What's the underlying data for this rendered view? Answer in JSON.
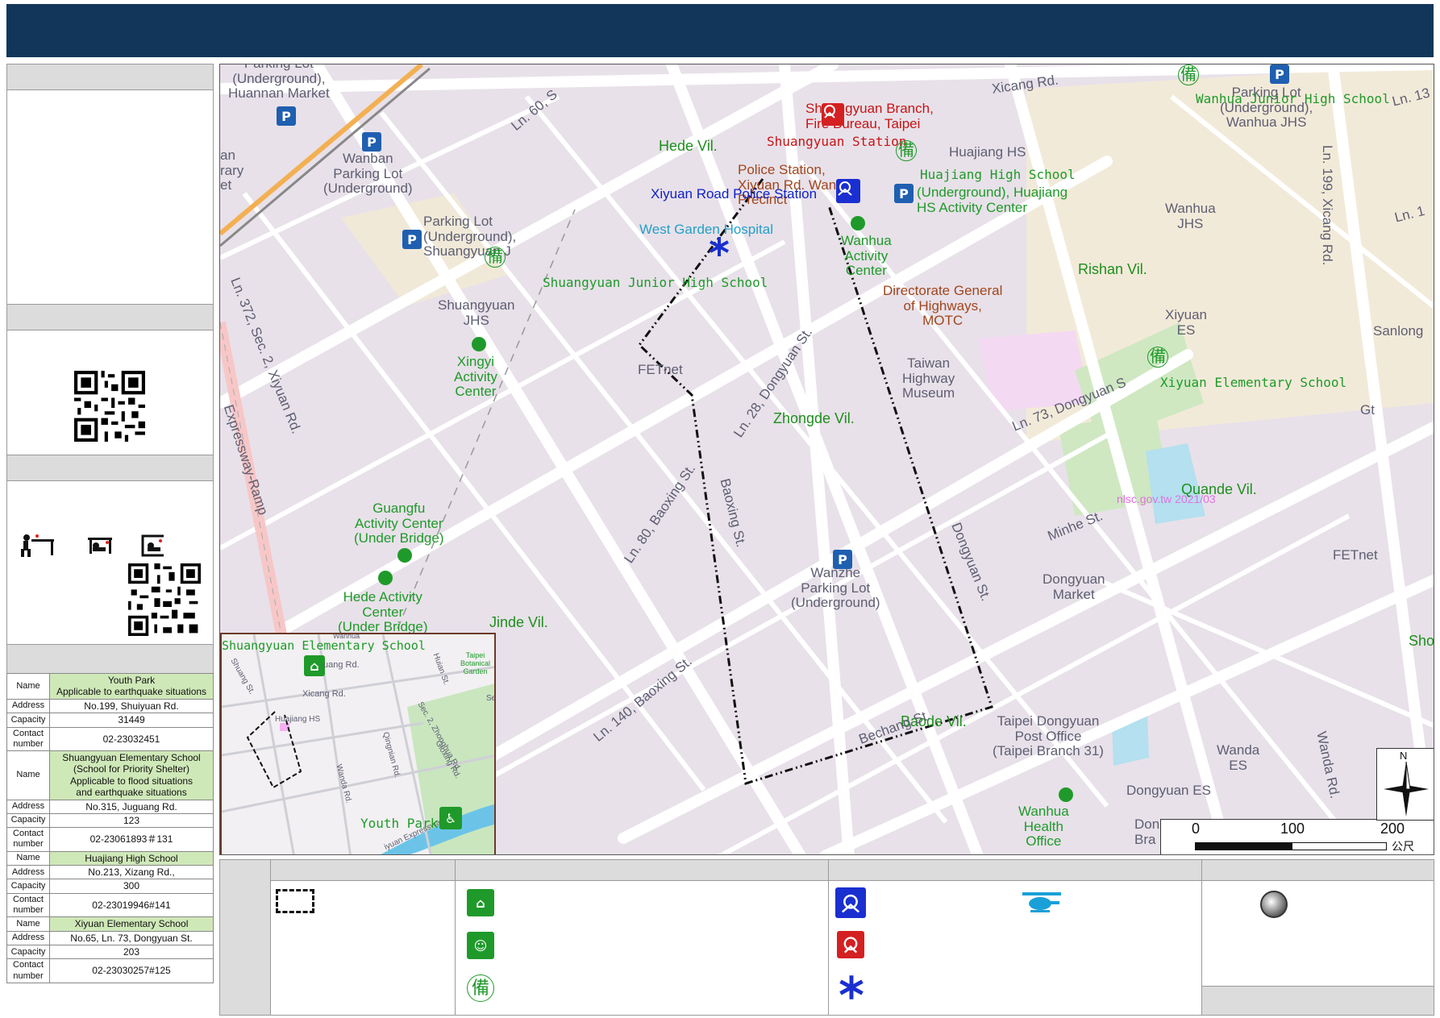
{
  "map": {
    "districts": [
      {
        "id": "hede",
        "label": "Hede Vil."
      },
      {
        "id": "rishan",
        "label": "Rishan Vil."
      },
      {
        "id": "zhongde",
        "label": "Zhongde Vil."
      },
      {
        "id": "quande",
        "label": "Quande Vil."
      },
      {
        "id": "jinde",
        "label": "Jinde Vil."
      },
      {
        "id": "baode",
        "label": "Baode Vil."
      },
      {
        "id": "sho",
        "label": "Sho"
      }
    ],
    "roads": {
      "xicang": "Xicang Rd.",
      "ln60": "Ln. 60, S",
      "ln372": "Ln. 372, Sec. 2, Xiyuan Rd.",
      "expressway": "Expressway-Ramp",
      "ln28": "Ln. 28, Dongyuan St.",
      "ln80": "Ln. 80, Baoxing St.",
      "baoxing": "Baoxing St.",
      "ln140": "Ln. 140, Baoxing St.",
      "beichang": "Bechang St.",
      "dongyuan": "Dongyuan St.",
      "ln73": "Ln. 73, Dongyuan S",
      "minhe": "Minhe St.",
      "ln199": "Ln. 199, Xicang Rd.",
      "wanda": "Wanda Rd.",
      "ln13": "Ln. 13",
      "ln1": "Ln. 1"
    },
    "places": {
      "parking_huannan": "Parking Lot\n(Underground),\nHuannan Market",
      "wanban": "Wanban\nParking Lot\n(Underground)",
      "library": "an\nrary\net",
      "parking_shuangyuan": "Parking Lot\n(Underground),\nShuangyuan J",
      "shuangyuan_jhs": "Shuangyuan\nJHS",
      "xingyi": "Xingyi\nActivity\nCenter",
      "shuangyuan_branch": "Shuangyuan Branch,\nFire Bureau, Taipei",
      "shuangyuan_station": "Shuangyuan Station",
      "police_station": "Police Station,\nXiyuan Rd. Wanhua\nPrecinct",
      "xiyuan_police": "Xiyuan Road Police Station",
      "west_garden": "West Garden Hospital",
      "shuangyuan_jhs_school": "Shuangyuan Junior High School",
      "huajiang_hs": "Huajiang HS",
      "huajiang_high": "Huajiang High School",
      "huajiang_center": "(Underground), Huajiang\nHS Activity Center",
      "wanhua_activity": "Wanhua\nActivity\nCenter",
      "parking_wanhua": "Parking Lot\n(Underground),\nWanhua JHS",
      "wanhua_high": "Wanhua Junior High School",
      "wanhua_jhs": "Wanhua\nJHS",
      "directorate": "Directorate General\nof Highways,\nMOTC",
      "museum": "Taiwan\nHighway\nMuseum",
      "xiyuan_es": "Xiyuan\nES",
      "xiyuan_elem": "Xiyuan Elementary School",
      "sanlong": "Sanlong",
      "gt": "Gt",
      "fetnet1": "FETnet",
      "fetnet2": "FETnet",
      "guangfu": "Guangfu\nActivity Center\n(Under Bridge)",
      "hede_center": "Hede Activity\nCenter\n(Under Bridge)",
      "wanzhe": "Wanzhe\nParking Lot\n(Underground)",
      "dongyuan_market": "Dongyuan\nMarket",
      "post_office": "Taipei Dongyuan\nPost Office\n(Taipei Branch 31)",
      "wanda_es": "Wanda\nES",
      "dongyuan_es": "Dongyuan ES",
      "health_office": "Wanhua\nHealth\nOffice",
      "don": "Don\nBra",
      "watermark": "nlsc.gov.tw 2021/03"
    },
    "scale": {
      "ticks": [
        "0",
        "100",
        "200"
      ],
      "unit": "公尺"
    },
    "north": "N",
    "bei_glyph": "備",
    "parking_glyph": "P"
  },
  "inset": {
    "shuangyuan_elem": "Shuangyuan Elementary School",
    "youth_park": "Youth Park",
    "juang": "uang Rd.",
    "xicang": "Xicang Rd.",
    "huajiang": "Huajiang HS",
    "huian": "Huian St.",
    "zhonghua": "Sec. 2, Zhonghua Rd.",
    "guoxing": "Gioxing Rd.",
    "wanda": "Wanda Rd.",
    "botanical": "Taipei\nBotanical\nGarden",
    "expressway": "iyuan Expressway",
    "sec": "Sec",
    "wanhua": "Wanhua",
    "shuang": "Shuang St.",
    "jinghan": "Qingnian Rd."
  },
  "shelters": [
    {
      "name": "Youth Park\nApplicable to earthquake situations",
      "address": "No.199, Shuiyuan Rd.",
      "capacity": "31449",
      "contact": "02-23032451"
    },
    {
      "name": "Shuangyuan Elementary School\n(School for Priority Shelter)\nApplicable to flood situations\nand earthquake situations",
      "address": "No.315, Juguang Rd.",
      "capacity": "123",
      "contact": "02-23061893＃131"
    },
    {
      "name": "Huajiang High School",
      "address": "No.213, Xizang Rd.,",
      "capacity": "300",
      "contact": "02-23019946#141"
    },
    {
      "name": "Xiyuan Elementary School",
      "address": "No.65, Ln. 73, Dongyuan St.",
      "capacity": "203",
      "contact": "02-23030257#125"
    }
  ],
  "table_keys": {
    "name": "Name",
    "address": "Address",
    "capacity": "Capacity",
    "contact": "Contact\nnumber"
  },
  "colors": {
    "header": "#12365a",
    "panel": "#dcdcdc",
    "shelter_green": "#1f9a2a",
    "police_blue": "#1a2fd0",
    "fire_red": "#d42020",
    "hospital_blue": "#1a2fd0",
    "parking_blue": "#1f5fb0",
    "highlight": "#cfe8b8"
  },
  "icons": [
    "qr-code-icon",
    "drop-cover-hold-icon",
    "shelter-icon",
    "evacuation-icon",
    "police-icon",
    "fire-icon",
    "hospital-icon",
    "helicopter-icon",
    "reserve-icon",
    "parking-icon",
    "north-arrow-icon",
    "marker-circle-icon"
  ]
}
